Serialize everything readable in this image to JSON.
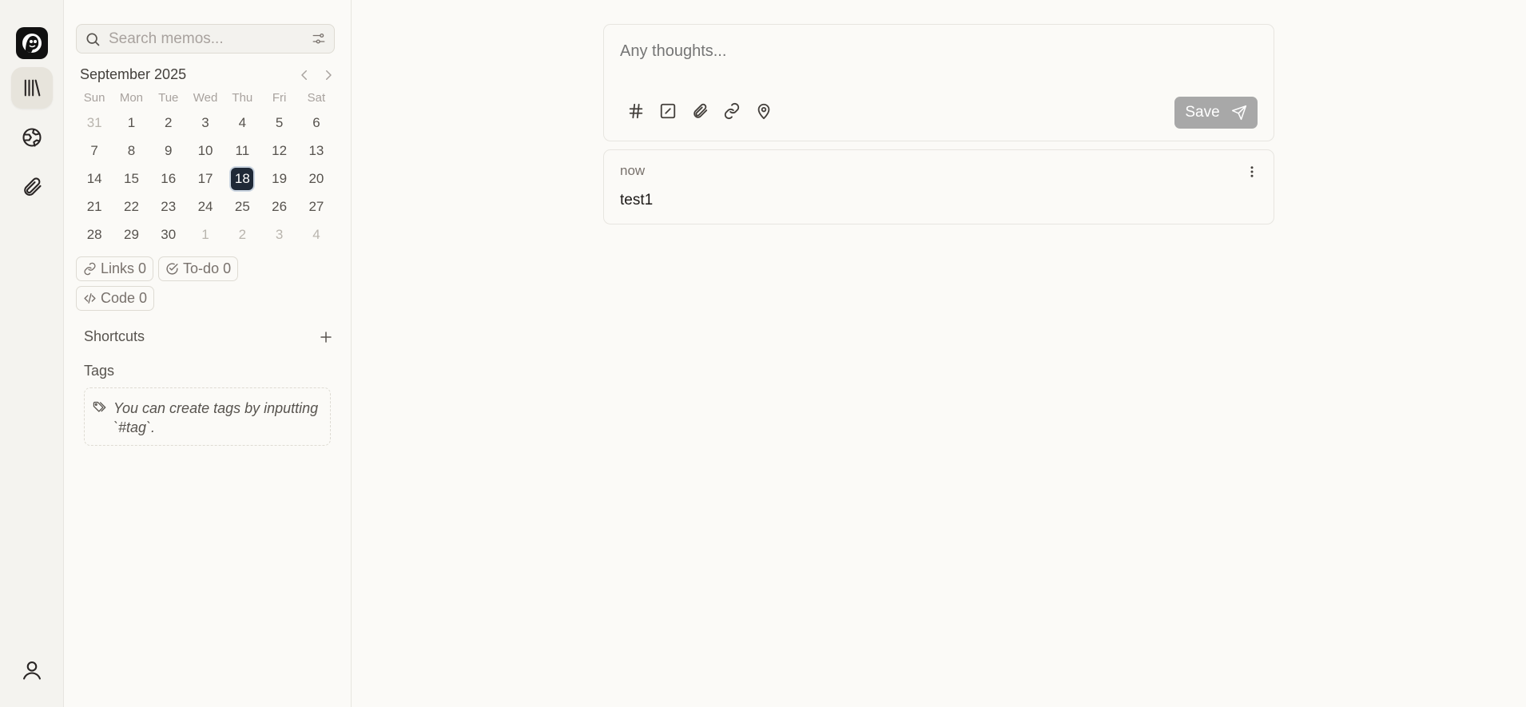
{
  "search": {
    "placeholder": "Search memos..."
  },
  "calendar": {
    "month_label": "September 2025",
    "weekdays": [
      "Sun",
      "Mon",
      "Tue",
      "Wed",
      "Thu",
      "Fri",
      "Sat"
    ],
    "weeks": [
      [
        "31",
        "1",
        "2",
        "3",
        "4",
        "5",
        "6"
      ],
      [
        "7",
        "8",
        "9",
        "10",
        "11",
        "12",
        "13"
      ],
      [
        "14",
        "15",
        "16",
        "17",
        "18",
        "19",
        "20"
      ],
      [
        "21",
        "22",
        "23",
        "24",
        "25",
        "26",
        "27"
      ],
      [
        "28",
        "29",
        "30",
        "1",
        "2",
        "3",
        "4"
      ]
    ],
    "selected_day": "18"
  },
  "stats": {
    "links": "Links 0",
    "todo": "To-do 0",
    "code": "Code 0"
  },
  "shortcuts": {
    "title": "Shortcuts"
  },
  "tags": {
    "title": "Tags",
    "hint": "You can create tags by inputting `#tag`."
  },
  "editor": {
    "placeholder": "Any thoughts...",
    "save_label": "Save"
  },
  "memos": [
    {
      "time": "now",
      "content": "test1"
    }
  ],
  "icons": {
    "logo": "memos-logo",
    "nav_home": "library-icon",
    "nav_explore": "globe-icon",
    "nav_resources": "paperclip-icon",
    "user": "user-icon"
  },
  "colors": {
    "selected_day_bg": "#1f2937",
    "save_button_bg": "#a8a8a8"
  }
}
